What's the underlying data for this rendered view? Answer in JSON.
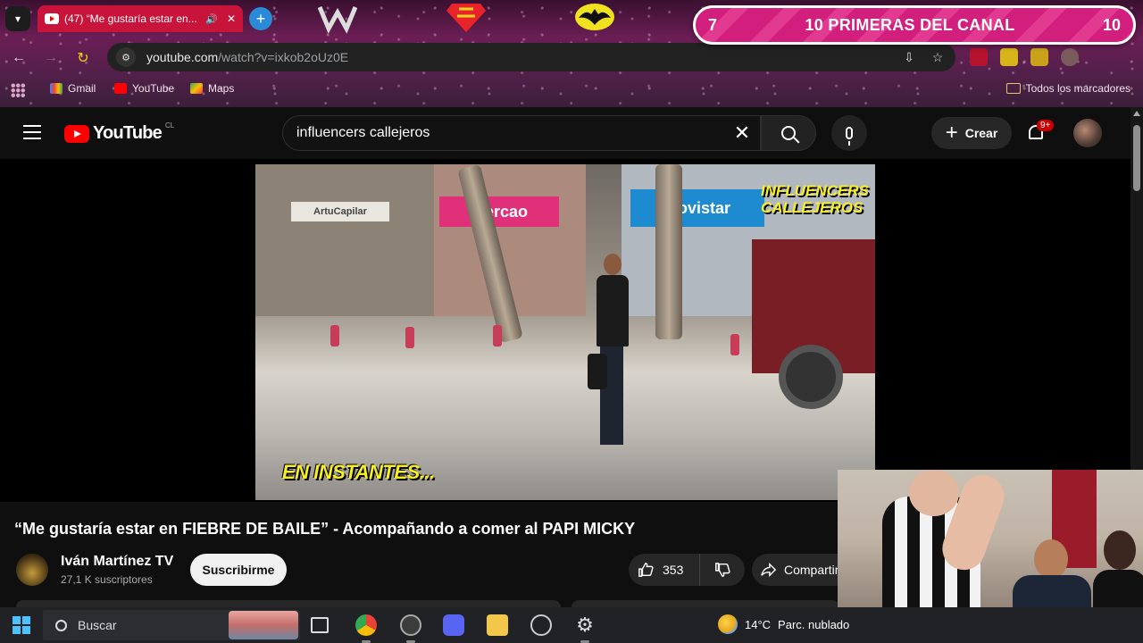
{
  "browser": {
    "tab": {
      "title": "(47) “Me gustaría estar en...",
      "audio_icon": "speaker-icon",
      "close_icon": "close-icon"
    },
    "new_tab_icon": "plus-icon",
    "address": {
      "host": "youtube.com",
      "path": "/watch?v=ixkob2oUz0E"
    },
    "bookmarks": [
      {
        "label": "Gmail",
        "icon": "gmail-icon"
      },
      {
        "label": "YouTube",
        "icon": "youtube-icon"
      },
      {
        "label": "Maps",
        "icon": "maps-icon"
      }
    ],
    "all_bookmarks": "Todos los marcadores"
  },
  "stream_overlay": {
    "left": "7",
    "title": "10 PRIMERAS DEL CANAL",
    "right": "10"
  },
  "youtube": {
    "country": "CL",
    "search_query": "influencers callejeros",
    "create_label": "Crear",
    "notification_badge": "9+",
    "video": {
      "brand_line1": "INFLUENCERS",
      "brand_line2": "CALLEJEROS",
      "caption": "EN INSTANTES...",
      "signs": [
        "mercao",
        "Movistar",
        "ArtuCapilar"
      ]
    },
    "title": "“Me gustaría estar en FIEBRE DE BAILE” - Acompañando a comer al PAPI MICKY",
    "channel": {
      "name": "Iván Martínez TV",
      "subscribers": "27,1 K suscriptores"
    },
    "subscribe_label": "Suscribirme",
    "likes": "353",
    "share_label": "Compartir"
  },
  "taskbar": {
    "search_placeholder": "Buscar",
    "weather_temp": "14°C",
    "weather_text": "Parc. nublado"
  },
  "colors": {
    "youtube_red": "#ff0000",
    "overlay_pink": "#d21e7c",
    "tab_red": "#c8133a"
  }
}
